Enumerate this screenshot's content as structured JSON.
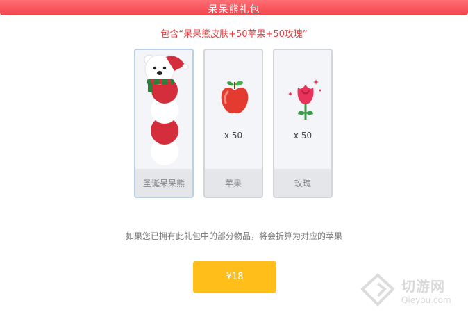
{
  "dialog": {
    "title": "呆呆熊礼包",
    "subtitle": "包含“呆呆熊皮肤+50苹果+50玫瑰”",
    "note": "如果您已拥有此礼包中的部分物品，将会折算为对应的苹果",
    "buy_label": "¥18"
  },
  "items": [
    {
      "name": "圣诞呆呆熊",
      "quantity": "",
      "icon": "christmas-bear-skin-icon"
    },
    {
      "name": "苹果",
      "quantity": "x 50",
      "icon": "apple-icon"
    },
    {
      "name": "玫瑰",
      "quantity": "x 50",
      "icon": "rose-icon"
    }
  ],
  "watermark": {
    "text": "切游网",
    "sub": "Qieyou.com"
  },
  "colors": {
    "title_bar": "#f2434b",
    "subtitle_text": "#e83a3a",
    "buy_button": "#ffbe1a",
    "card_bg": "#f4f5f8",
    "card_footer": "#e5e6ea"
  }
}
